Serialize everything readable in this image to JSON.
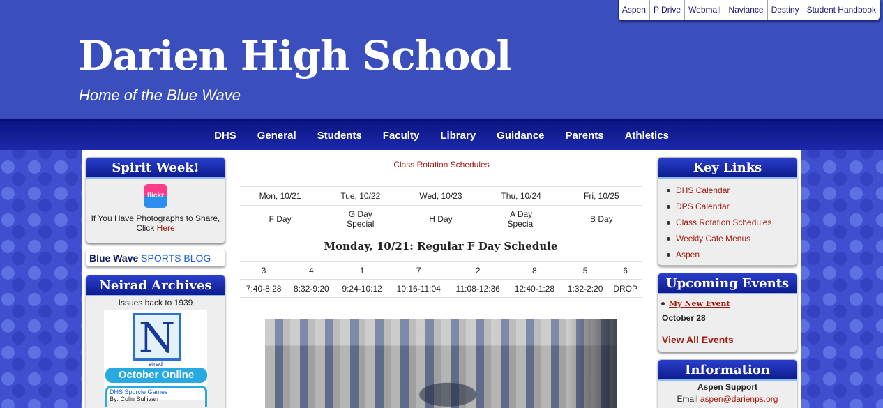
{
  "top_links": [
    "Aspen",
    "P Drive",
    "Webmail",
    "Naviance",
    "Destiny",
    "Student Handbook"
  ],
  "site": {
    "title": "Darien High School",
    "tagline": "Home of the Blue Wave"
  },
  "nav": [
    "DHS",
    "General",
    "Students",
    "Faculty",
    "Library",
    "Guidance",
    "Parents",
    "Athletics"
  ],
  "left": {
    "spirit": {
      "title": "Spirit Week!",
      "icon_label": "flickr",
      "text": "If You Have Photographs to Share, Click",
      "link": "Here"
    },
    "blog": {
      "part1": "Blue Wave",
      "part2": "SPORTS BLOG"
    },
    "neirad": {
      "title": "Neirad Archives",
      "subtitle": "Issues back to 1939",
      "logo_letter": "N",
      "logo_word": "eirad",
      "october": "October Online",
      "sporcle_title": "DHS Sporcle Games",
      "sporcle_by": "By: Colin Sullivan"
    }
  },
  "center": {
    "link": "Class Rotation Schedules",
    "days": [
      {
        "date": "Mon, 10/21",
        "day": "F Day",
        "note": ""
      },
      {
        "date": "Tue, 10/22",
        "day": "G Day",
        "note": "Special"
      },
      {
        "date": "Wed, 10/23",
        "day": "H Day",
        "note": ""
      },
      {
        "date": "Thu, 10/24",
        "day": "A Day",
        "note": "Special"
      },
      {
        "date": "Fri, 10/25",
        "day": "B Day",
        "note": ""
      }
    ],
    "schedule_title": "Monday, 10/21: Regular F Day Schedule",
    "periods": [
      "3",
      "4",
      "1",
      "7",
      "2",
      "8",
      "5",
      "6"
    ],
    "times": [
      "7:40-8:28",
      "8:32-9:20",
      "9:24-10:12",
      "10:16-11:04",
      "11:08-12:36",
      "12:40-1:28",
      "1:32-2:20",
      "DROP"
    ]
  },
  "right": {
    "key_links": {
      "title": "Key Links",
      "items": [
        "DHS Calendar",
        "DPS Calendar",
        "Class Rotation Schedules",
        "Weekly Cafe Menus",
        "Aspen"
      ]
    },
    "events": {
      "title": "Upcoming Events",
      "event": "My New Event",
      "date": "October 28",
      "view_all": "View All Events"
    },
    "info": {
      "title": "Information",
      "heading": "Aspen Support",
      "email_label": "Email",
      "email": "aspen@darienps.org"
    }
  },
  "colors": {
    "header_blue": "#3a4fbd",
    "nav_blue": "#0b1585",
    "link_red": "#a41a10"
  }
}
